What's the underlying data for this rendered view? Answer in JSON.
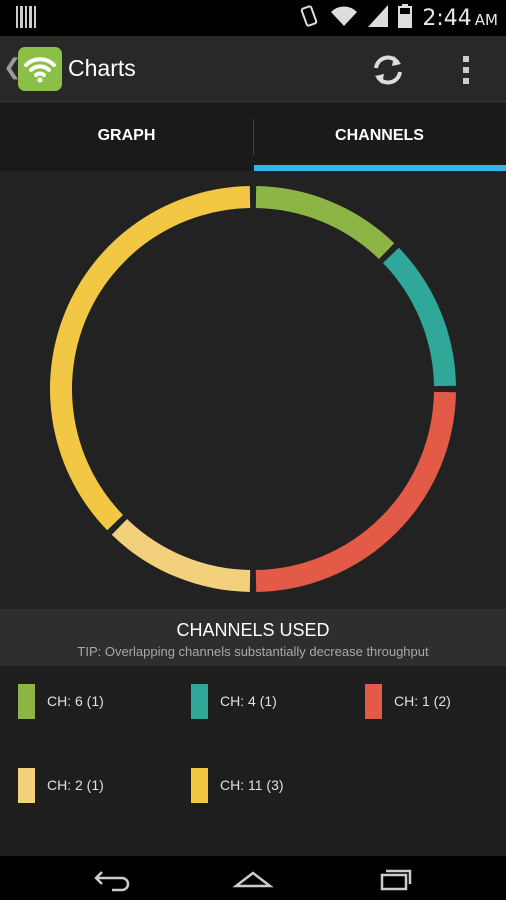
{
  "status_bar": {
    "time": "2:44",
    "ampm": "AM",
    "icons": [
      "barcode-icon",
      "vibrate-icon",
      "wifi-icon",
      "signal-icon",
      "battery-icon"
    ]
  },
  "action_bar": {
    "title": "Charts",
    "icons": [
      "back-chevron-icon",
      "wifi-app-icon",
      "refresh-icon",
      "overflow-menu-icon"
    ]
  },
  "tabs": [
    {
      "label": "GRAPH",
      "selected": false
    },
    {
      "label": "CHANNELS",
      "selected": true
    }
  ],
  "colors": {
    "ch6": "#8cb545",
    "ch4": "#2fa899",
    "ch1": "#e35a47",
    "ch2": "#f3d17c",
    "ch11": "#f2c744",
    "tab_indicator": "#33b5e5"
  },
  "chart_data": {
    "type": "pie",
    "style": "donut-ring",
    "categories": [
      "CH: 6",
      "CH: 4",
      "CH: 1",
      "CH: 2",
      "CH: 11"
    ],
    "values": [
      1,
      1,
      2,
      1,
      3
    ],
    "colors": [
      "#8cb545",
      "#2fa899",
      "#e35a47",
      "#f3d17c",
      "#f2c744"
    ]
  },
  "legend": {
    "title": "CHANNELS USED",
    "tip": "TIP: Overlapping channels substantially decrease throughput",
    "items": [
      {
        "label": "CH: 6 (1)",
        "color": "#8cb545"
      },
      {
        "label": "CH: 4 (1)",
        "color": "#2fa899"
      },
      {
        "label": "CH: 1 (2)",
        "color": "#e35a47"
      },
      {
        "label": "CH: 2 (1)",
        "color": "#f3d17c"
      },
      {
        "label": "CH: 11 (3)",
        "color": "#f2c744"
      }
    ]
  },
  "nav_bar": {
    "icons": [
      "back-icon",
      "home-icon",
      "recents-icon"
    ]
  }
}
